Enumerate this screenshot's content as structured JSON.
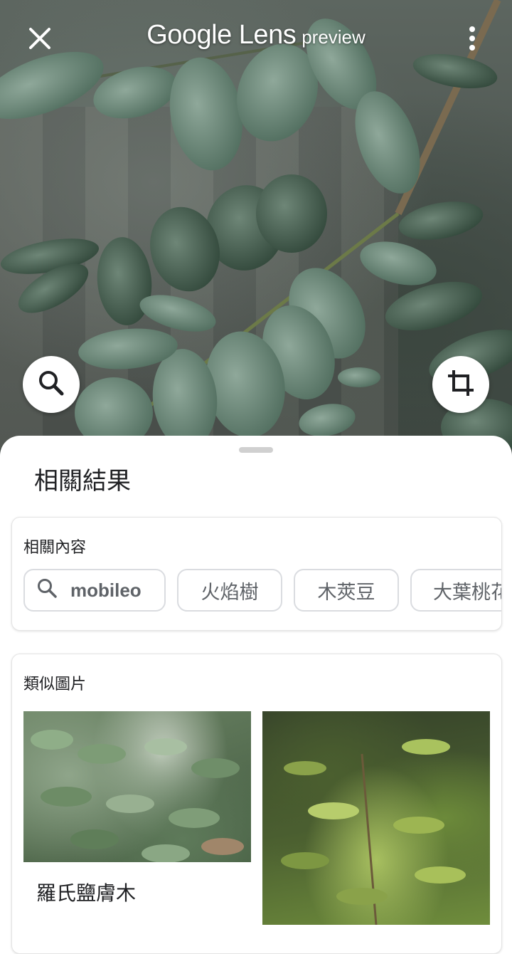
{
  "header": {
    "brand": "Google Lens",
    "tag": "preview"
  },
  "icons": {
    "close": "close-icon",
    "menu": "more-vert-icon",
    "search": "search-icon",
    "crop": "crop-icon"
  },
  "sheet": {
    "title": "相關結果"
  },
  "related": {
    "label": "相關內容",
    "chips": [
      "mobileo",
      "火焰樹",
      "木莢豆",
      "大葉桃花"
    ]
  },
  "similar": {
    "label": "類似圖片",
    "items": [
      {
        "caption": "羅氏鹽膚木"
      }
    ]
  }
}
